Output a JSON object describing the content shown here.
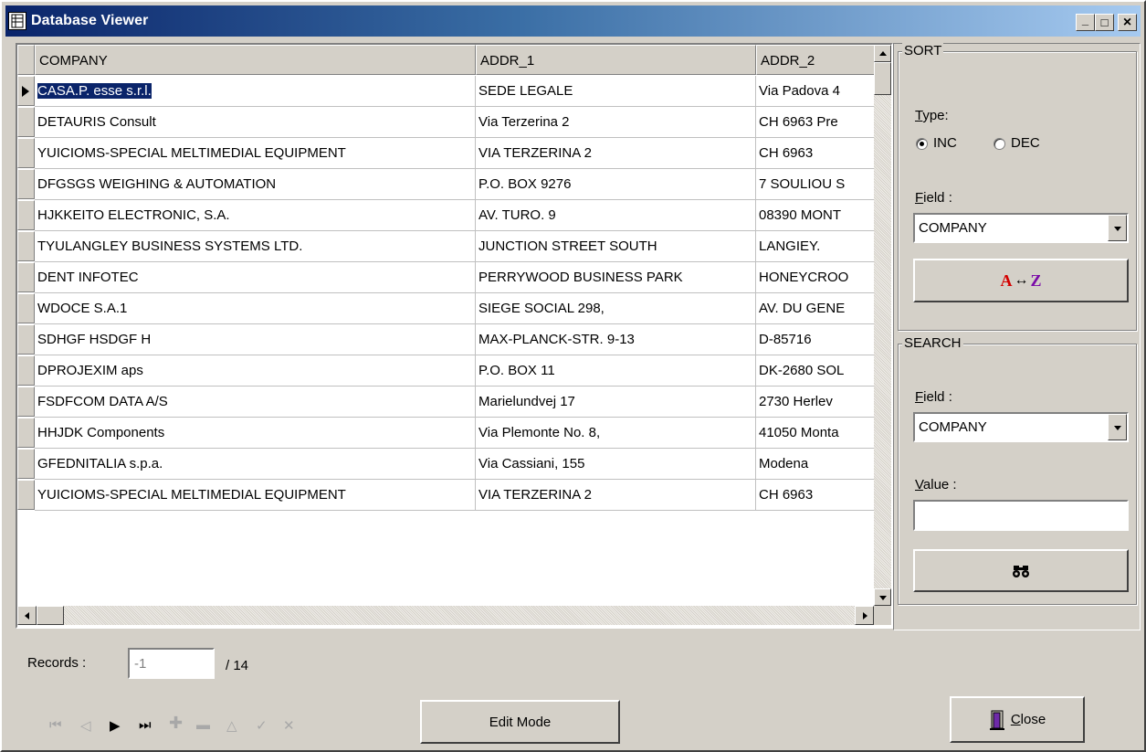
{
  "window": {
    "title": "Database Viewer",
    "min_glyph": "_",
    "max_glyph": "□",
    "close_glyph": "×"
  },
  "grid": {
    "columns": [
      "COMPANY",
      "ADDR_1",
      "ADDR_2"
    ],
    "rows": [
      [
        "CASA.P. esse s.r.l.",
        "SEDE LEGALE",
        "Via Padova 4"
      ],
      [
        "DETAURIS Consult",
        "Via Terzerina 2",
        "CH 6963 Pre"
      ],
      [
        "YUICIOMS-SPECIAL MELTIMEDIAL EQUIPMENT",
        "VIA TERZERINA 2",
        "CH 6963"
      ],
      [
        "DFGSGS WEIGHING & AUTOMATION",
        "P.O. BOX 9276",
        "7 SOULIOU S"
      ],
      [
        "HJKKEITO ELECTRONIC, S.A.",
        "AV. TURO. 9",
        "08390 MONT"
      ],
      [
        "TYULANGLEY BUSINESS SYSTEMS LTD.",
        "JUNCTION STREET SOUTH",
        "LANGIEY."
      ],
      [
        "DENT INFOTEC",
        "PERRYWOOD BUSINESS PARK",
        "HONEYCROO"
      ],
      [
        "WDOCE S.A.1",
        "SIEGE SOCIAL 298,",
        "AV. DU GENE"
      ],
      [
        "SDHGF HSDGF H",
        "MAX-PLANCK-STR. 9-13",
        "D-85716"
      ],
      [
        "DPROJEXIM aps",
        "P.O. BOX 11",
        "DK-2680 SOL"
      ],
      [
        "FSDFCOM DATA A/S",
        "Marielundvej 17",
        "2730 Herlev"
      ],
      [
        "HHJDK Components",
        "Via Plemonte No. 8,",
        "41050 Monta"
      ],
      [
        "GFEDNITALIA s.p.a.",
        "Via Cassiani, 155",
        "Modena"
      ],
      [
        "YUICIOMS-SPECIAL MELTIMEDIAL EQUIPMENT",
        "VIA TERZERINA 2",
        "CH 6963"
      ]
    ]
  },
  "sort": {
    "group_title": "SORT",
    "type_label": "Type:",
    "inc_label": "INC",
    "dec_label": "DEC",
    "selected": "INC",
    "field_label": "Field :",
    "field_value": "COMPANY",
    "sort_button_a": "A",
    "sort_button_arrow": "↔",
    "sort_button_z": "Z",
    "accent_a": "#d40000",
    "accent_z": "#7a0aa8"
  },
  "search": {
    "group_title": "SEARCH",
    "field_label": "Field :",
    "field_value": "COMPANY",
    "value_label": "Value :",
    "value_text": "",
    "search_icon": "binoculars-icon"
  },
  "footer": {
    "records_label": "Records :",
    "records_value": "-1",
    "records_total": "/ 14",
    "edit_mode_label": "Edit Mode",
    "close_label": "Close"
  }
}
